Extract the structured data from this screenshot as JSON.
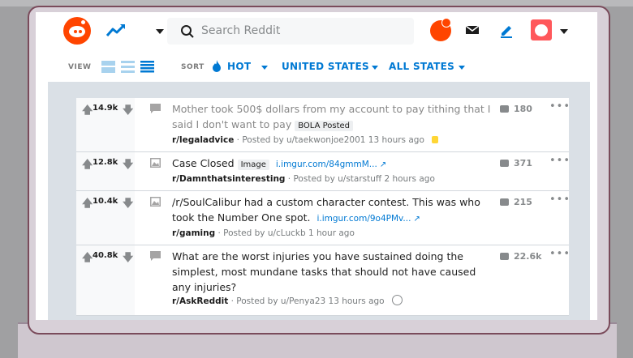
{
  "header": {
    "search_placeholder": "Search Reddit"
  },
  "toolbar": {
    "view_label": "VIEW",
    "sort_label": "SORT",
    "sort_value": "HOT",
    "region_value": "UNITED STATES",
    "state_value": "ALL STATES"
  },
  "colors": {
    "accent": "#ff4500",
    "link": "#0079d3",
    "feed_bg": "#dae0e6"
  },
  "posts": [
    {
      "score": "14.9k",
      "title": "Mother took 500$ dollars from my account to pay tithing that I said I don't want to pay",
      "flair": "BOLA Posted",
      "link": "",
      "subreddit": "r/legaladvice",
      "meta": "· Posted by u/taekwonjoe2001 13 hours ago",
      "comments": "180",
      "thumb_icon": "text-post-icon"
    },
    {
      "score": "12.8k",
      "title": "Case Closed",
      "flair": "Image",
      "link": "i.imgur.com/84gmmM...",
      "subreddit": "r/Damnthatsinteresting",
      "meta": "· Posted by u/starstuff 2 hours ago",
      "comments": "371",
      "thumb_icon": "image-post-icon"
    },
    {
      "score": "10.4k",
      "title": "/r/SoulCalibur had a custom character contest. This was who took the Number One spot.",
      "flair": "",
      "link": "i.imgur.com/9o4PMv...",
      "subreddit": "r/gaming",
      "meta": "· Posted by u/cLuckb 1 hour ago",
      "comments": "215",
      "thumb_icon": "image-post-icon"
    },
    {
      "score": "40.8k",
      "title": "What are the worst injuries you have sustained doing the simplest, most mundane tasks that should not have caused any injuries?",
      "flair": "",
      "link": "",
      "subreddit": "r/AskReddit",
      "meta": "· Posted by u/Penya23 13 hours ago",
      "comments": "22.6k",
      "thumb_icon": "text-post-icon"
    }
  ]
}
